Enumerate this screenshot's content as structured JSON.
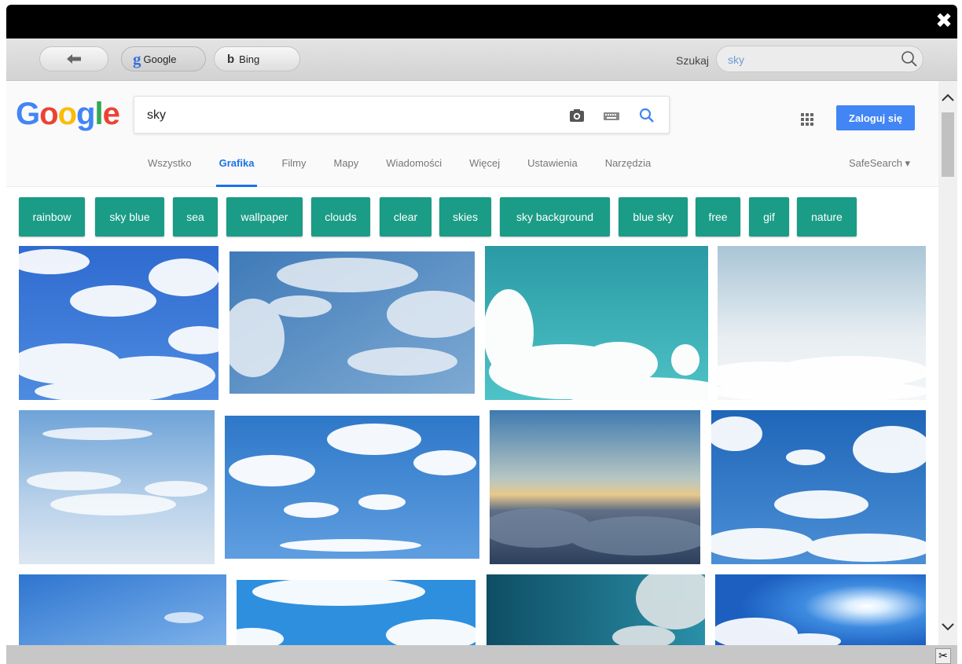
{
  "window": {
    "close_glyph": "✖"
  },
  "toolbar": {
    "back_icon": "arrow-left-icon",
    "engines": [
      {
        "logo": "g",
        "label": "Google",
        "active": true
      },
      {
        "logo": "b",
        "label": "Bing",
        "active": false
      }
    ],
    "search_label": "Szukaj",
    "search_value": "sky"
  },
  "google": {
    "logo": [
      "G",
      "o",
      "o",
      "g",
      "l",
      "e"
    ],
    "logo_colors": [
      "#4285f4",
      "#ea4335",
      "#fbbc05",
      "#4285f4",
      "#34a853",
      "#ea4335"
    ],
    "query": "sky",
    "login_label": "Zaloguj się",
    "tabs": [
      "Wszystko",
      "Grafika",
      "Filmy",
      "Mapy",
      "Wiadomości",
      "Więcej",
      "Ustawienia",
      "Narzędzia"
    ],
    "active_tab": "Grafika",
    "safesearch_label": "SafeSearch ▾",
    "accent_color": "#1a73e8",
    "chip_color": "#1a9c86"
  },
  "chips": [
    "rainbow",
    "sky blue",
    "sea",
    "wallpaper",
    "clouds",
    "clear",
    "skies",
    "sky background",
    "blue sky",
    "free",
    "gif",
    "nature"
  ],
  "status": {
    "scissors_glyph": "✂"
  }
}
